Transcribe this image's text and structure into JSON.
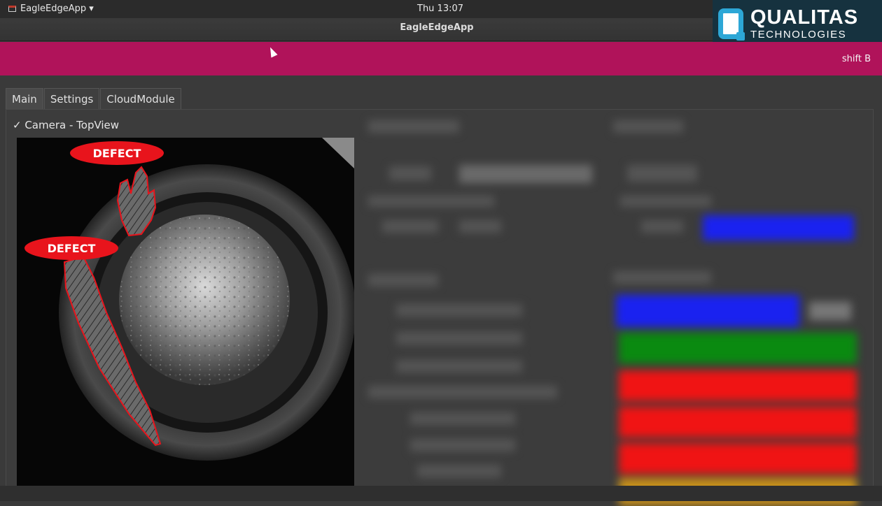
{
  "system_bar": {
    "app_menu_label": "EagleEdgeApp ▾",
    "clock": "Thu 13:07"
  },
  "window": {
    "title": "EagleEdgeApp"
  },
  "logo": {
    "name": "QUALITAS",
    "subtitle": "TECHNOLOGIES"
  },
  "banner": {
    "shift": "shift B",
    "color": "#b0135a"
  },
  "tabs": [
    {
      "label": "Main",
      "active": true
    },
    {
      "label": "Settings",
      "active": false
    },
    {
      "label": "CloudModule",
      "active": false
    }
  ],
  "camera_group": {
    "label": "✓ Camera - TopView"
  },
  "defects": [
    {
      "label": "DEFECT"
    },
    {
      "label": "DEFECT"
    }
  ],
  "colors": {
    "defect": "#e8141c",
    "status_blue": "#1a22f0",
    "status_green": "#0a8a10",
    "status_red": "#f01414",
    "status_amber": "#c8901a"
  }
}
